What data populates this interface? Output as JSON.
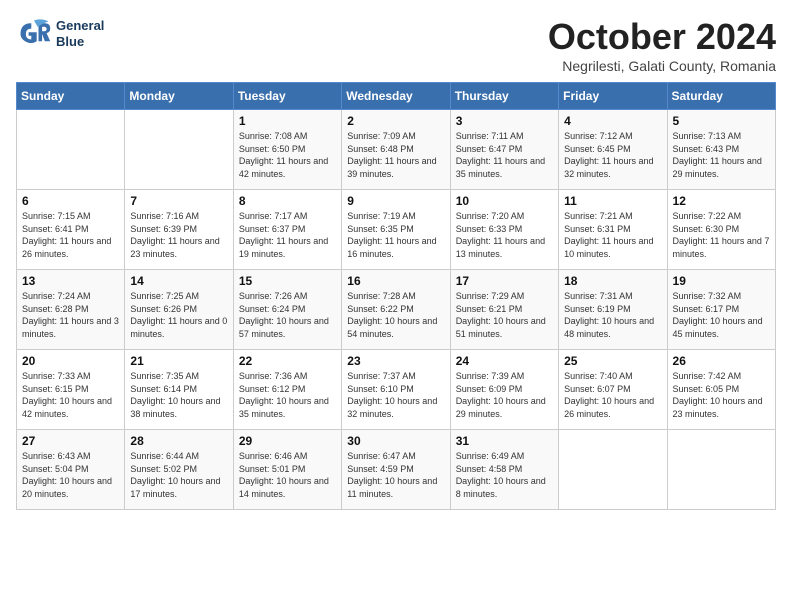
{
  "header": {
    "logo_line1": "General",
    "logo_line2": "Blue",
    "month": "October 2024",
    "location": "Negrilesti, Galati County, Romania"
  },
  "weekdays": [
    "Sunday",
    "Monday",
    "Tuesday",
    "Wednesday",
    "Thursday",
    "Friday",
    "Saturday"
  ],
  "weeks": [
    [
      {
        "day": "",
        "sunrise": "",
        "sunset": "",
        "daylight": ""
      },
      {
        "day": "",
        "sunrise": "",
        "sunset": "",
        "daylight": ""
      },
      {
        "day": "1",
        "sunrise": "Sunrise: 7:08 AM",
        "sunset": "Sunset: 6:50 PM",
        "daylight": "Daylight: 11 hours and 42 minutes."
      },
      {
        "day": "2",
        "sunrise": "Sunrise: 7:09 AM",
        "sunset": "Sunset: 6:48 PM",
        "daylight": "Daylight: 11 hours and 39 minutes."
      },
      {
        "day": "3",
        "sunrise": "Sunrise: 7:11 AM",
        "sunset": "Sunset: 6:47 PM",
        "daylight": "Daylight: 11 hours and 35 minutes."
      },
      {
        "day": "4",
        "sunrise": "Sunrise: 7:12 AM",
        "sunset": "Sunset: 6:45 PM",
        "daylight": "Daylight: 11 hours and 32 minutes."
      },
      {
        "day": "5",
        "sunrise": "Sunrise: 7:13 AM",
        "sunset": "Sunset: 6:43 PM",
        "daylight": "Daylight: 11 hours and 29 minutes."
      }
    ],
    [
      {
        "day": "6",
        "sunrise": "Sunrise: 7:15 AM",
        "sunset": "Sunset: 6:41 PM",
        "daylight": "Daylight: 11 hours and 26 minutes."
      },
      {
        "day": "7",
        "sunrise": "Sunrise: 7:16 AM",
        "sunset": "Sunset: 6:39 PM",
        "daylight": "Daylight: 11 hours and 23 minutes."
      },
      {
        "day": "8",
        "sunrise": "Sunrise: 7:17 AM",
        "sunset": "Sunset: 6:37 PM",
        "daylight": "Daylight: 11 hours and 19 minutes."
      },
      {
        "day": "9",
        "sunrise": "Sunrise: 7:19 AM",
        "sunset": "Sunset: 6:35 PM",
        "daylight": "Daylight: 11 hours and 16 minutes."
      },
      {
        "day": "10",
        "sunrise": "Sunrise: 7:20 AM",
        "sunset": "Sunset: 6:33 PM",
        "daylight": "Daylight: 11 hours and 13 minutes."
      },
      {
        "day": "11",
        "sunrise": "Sunrise: 7:21 AM",
        "sunset": "Sunset: 6:31 PM",
        "daylight": "Daylight: 11 hours and 10 minutes."
      },
      {
        "day": "12",
        "sunrise": "Sunrise: 7:22 AM",
        "sunset": "Sunset: 6:30 PM",
        "daylight": "Daylight: 11 hours and 7 minutes."
      }
    ],
    [
      {
        "day": "13",
        "sunrise": "Sunrise: 7:24 AM",
        "sunset": "Sunset: 6:28 PM",
        "daylight": "Daylight: 11 hours and 3 minutes."
      },
      {
        "day": "14",
        "sunrise": "Sunrise: 7:25 AM",
        "sunset": "Sunset: 6:26 PM",
        "daylight": "Daylight: 11 hours and 0 minutes."
      },
      {
        "day": "15",
        "sunrise": "Sunrise: 7:26 AM",
        "sunset": "Sunset: 6:24 PM",
        "daylight": "Daylight: 10 hours and 57 minutes."
      },
      {
        "day": "16",
        "sunrise": "Sunrise: 7:28 AM",
        "sunset": "Sunset: 6:22 PM",
        "daylight": "Daylight: 10 hours and 54 minutes."
      },
      {
        "day": "17",
        "sunrise": "Sunrise: 7:29 AM",
        "sunset": "Sunset: 6:21 PM",
        "daylight": "Daylight: 10 hours and 51 minutes."
      },
      {
        "day": "18",
        "sunrise": "Sunrise: 7:31 AM",
        "sunset": "Sunset: 6:19 PM",
        "daylight": "Daylight: 10 hours and 48 minutes."
      },
      {
        "day": "19",
        "sunrise": "Sunrise: 7:32 AM",
        "sunset": "Sunset: 6:17 PM",
        "daylight": "Daylight: 10 hours and 45 minutes."
      }
    ],
    [
      {
        "day": "20",
        "sunrise": "Sunrise: 7:33 AM",
        "sunset": "Sunset: 6:15 PM",
        "daylight": "Daylight: 10 hours and 42 minutes."
      },
      {
        "day": "21",
        "sunrise": "Sunrise: 7:35 AM",
        "sunset": "Sunset: 6:14 PM",
        "daylight": "Daylight: 10 hours and 38 minutes."
      },
      {
        "day": "22",
        "sunrise": "Sunrise: 7:36 AM",
        "sunset": "Sunset: 6:12 PM",
        "daylight": "Daylight: 10 hours and 35 minutes."
      },
      {
        "day": "23",
        "sunrise": "Sunrise: 7:37 AM",
        "sunset": "Sunset: 6:10 PM",
        "daylight": "Daylight: 10 hours and 32 minutes."
      },
      {
        "day": "24",
        "sunrise": "Sunrise: 7:39 AM",
        "sunset": "Sunset: 6:09 PM",
        "daylight": "Daylight: 10 hours and 29 minutes."
      },
      {
        "day": "25",
        "sunrise": "Sunrise: 7:40 AM",
        "sunset": "Sunset: 6:07 PM",
        "daylight": "Daylight: 10 hours and 26 minutes."
      },
      {
        "day": "26",
        "sunrise": "Sunrise: 7:42 AM",
        "sunset": "Sunset: 6:05 PM",
        "daylight": "Daylight: 10 hours and 23 minutes."
      }
    ],
    [
      {
        "day": "27",
        "sunrise": "Sunrise: 6:43 AM",
        "sunset": "Sunset: 5:04 PM",
        "daylight": "Daylight: 10 hours and 20 minutes."
      },
      {
        "day": "28",
        "sunrise": "Sunrise: 6:44 AM",
        "sunset": "Sunset: 5:02 PM",
        "daylight": "Daylight: 10 hours and 17 minutes."
      },
      {
        "day": "29",
        "sunrise": "Sunrise: 6:46 AM",
        "sunset": "Sunset: 5:01 PM",
        "daylight": "Daylight: 10 hours and 14 minutes."
      },
      {
        "day": "30",
        "sunrise": "Sunrise: 6:47 AM",
        "sunset": "Sunset: 4:59 PM",
        "daylight": "Daylight: 10 hours and 11 minutes."
      },
      {
        "day": "31",
        "sunrise": "Sunrise: 6:49 AM",
        "sunset": "Sunset: 4:58 PM",
        "daylight": "Daylight: 10 hours and 8 minutes."
      },
      {
        "day": "",
        "sunrise": "",
        "sunset": "",
        "daylight": ""
      },
      {
        "day": "",
        "sunrise": "",
        "sunset": "",
        "daylight": ""
      }
    ]
  ]
}
